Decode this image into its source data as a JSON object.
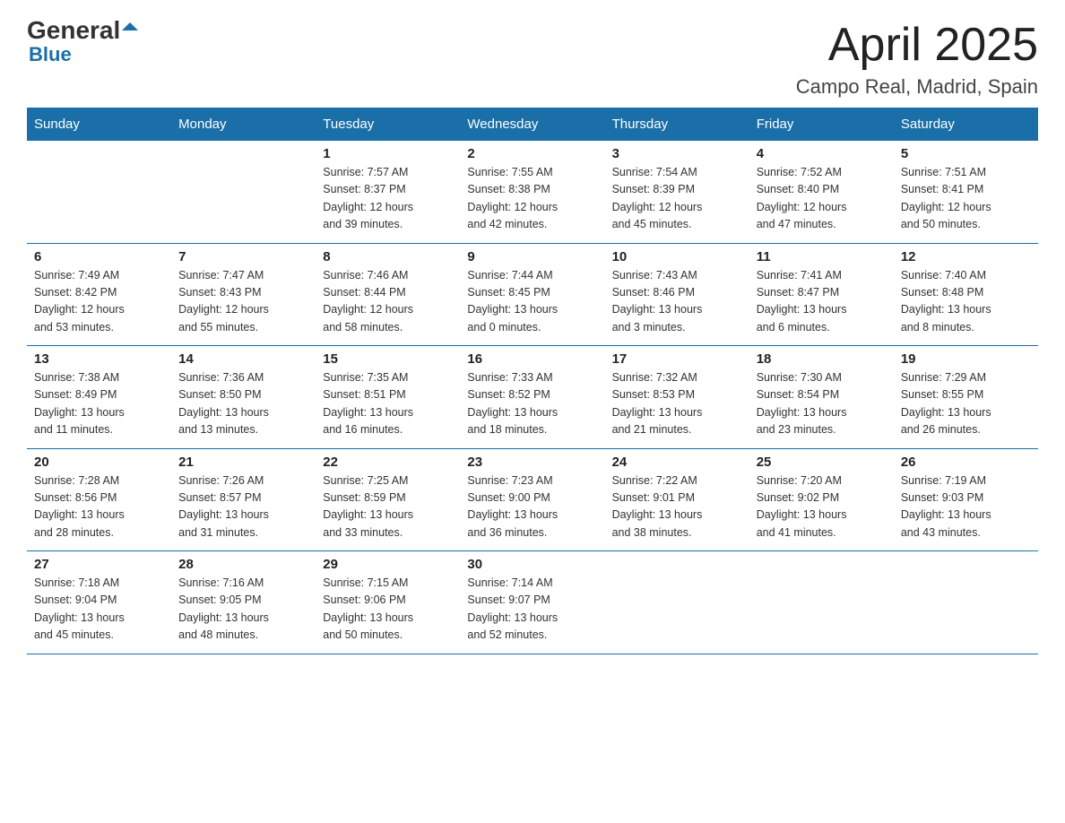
{
  "logo": {
    "text_general": "General",
    "text_blue": "Blue"
  },
  "title": "April 2025",
  "subtitle": "Campo Real, Madrid, Spain",
  "weekdays": [
    "Sunday",
    "Monday",
    "Tuesday",
    "Wednesday",
    "Thursday",
    "Friday",
    "Saturday"
  ],
  "weeks": [
    [
      {
        "day": "",
        "info": ""
      },
      {
        "day": "",
        "info": ""
      },
      {
        "day": "1",
        "info": "Sunrise: 7:57 AM\nSunset: 8:37 PM\nDaylight: 12 hours\nand 39 minutes."
      },
      {
        "day": "2",
        "info": "Sunrise: 7:55 AM\nSunset: 8:38 PM\nDaylight: 12 hours\nand 42 minutes."
      },
      {
        "day": "3",
        "info": "Sunrise: 7:54 AM\nSunset: 8:39 PM\nDaylight: 12 hours\nand 45 minutes."
      },
      {
        "day": "4",
        "info": "Sunrise: 7:52 AM\nSunset: 8:40 PM\nDaylight: 12 hours\nand 47 minutes."
      },
      {
        "day": "5",
        "info": "Sunrise: 7:51 AM\nSunset: 8:41 PM\nDaylight: 12 hours\nand 50 minutes."
      }
    ],
    [
      {
        "day": "6",
        "info": "Sunrise: 7:49 AM\nSunset: 8:42 PM\nDaylight: 12 hours\nand 53 minutes."
      },
      {
        "day": "7",
        "info": "Sunrise: 7:47 AM\nSunset: 8:43 PM\nDaylight: 12 hours\nand 55 minutes."
      },
      {
        "day": "8",
        "info": "Sunrise: 7:46 AM\nSunset: 8:44 PM\nDaylight: 12 hours\nand 58 minutes."
      },
      {
        "day": "9",
        "info": "Sunrise: 7:44 AM\nSunset: 8:45 PM\nDaylight: 13 hours\nand 0 minutes."
      },
      {
        "day": "10",
        "info": "Sunrise: 7:43 AM\nSunset: 8:46 PM\nDaylight: 13 hours\nand 3 minutes."
      },
      {
        "day": "11",
        "info": "Sunrise: 7:41 AM\nSunset: 8:47 PM\nDaylight: 13 hours\nand 6 minutes."
      },
      {
        "day": "12",
        "info": "Sunrise: 7:40 AM\nSunset: 8:48 PM\nDaylight: 13 hours\nand 8 minutes."
      }
    ],
    [
      {
        "day": "13",
        "info": "Sunrise: 7:38 AM\nSunset: 8:49 PM\nDaylight: 13 hours\nand 11 minutes."
      },
      {
        "day": "14",
        "info": "Sunrise: 7:36 AM\nSunset: 8:50 PM\nDaylight: 13 hours\nand 13 minutes."
      },
      {
        "day": "15",
        "info": "Sunrise: 7:35 AM\nSunset: 8:51 PM\nDaylight: 13 hours\nand 16 minutes."
      },
      {
        "day": "16",
        "info": "Sunrise: 7:33 AM\nSunset: 8:52 PM\nDaylight: 13 hours\nand 18 minutes."
      },
      {
        "day": "17",
        "info": "Sunrise: 7:32 AM\nSunset: 8:53 PM\nDaylight: 13 hours\nand 21 minutes."
      },
      {
        "day": "18",
        "info": "Sunrise: 7:30 AM\nSunset: 8:54 PM\nDaylight: 13 hours\nand 23 minutes."
      },
      {
        "day": "19",
        "info": "Sunrise: 7:29 AM\nSunset: 8:55 PM\nDaylight: 13 hours\nand 26 minutes."
      }
    ],
    [
      {
        "day": "20",
        "info": "Sunrise: 7:28 AM\nSunset: 8:56 PM\nDaylight: 13 hours\nand 28 minutes."
      },
      {
        "day": "21",
        "info": "Sunrise: 7:26 AM\nSunset: 8:57 PM\nDaylight: 13 hours\nand 31 minutes."
      },
      {
        "day": "22",
        "info": "Sunrise: 7:25 AM\nSunset: 8:59 PM\nDaylight: 13 hours\nand 33 minutes."
      },
      {
        "day": "23",
        "info": "Sunrise: 7:23 AM\nSunset: 9:00 PM\nDaylight: 13 hours\nand 36 minutes."
      },
      {
        "day": "24",
        "info": "Sunrise: 7:22 AM\nSunset: 9:01 PM\nDaylight: 13 hours\nand 38 minutes."
      },
      {
        "day": "25",
        "info": "Sunrise: 7:20 AM\nSunset: 9:02 PM\nDaylight: 13 hours\nand 41 minutes."
      },
      {
        "day": "26",
        "info": "Sunrise: 7:19 AM\nSunset: 9:03 PM\nDaylight: 13 hours\nand 43 minutes."
      }
    ],
    [
      {
        "day": "27",
        "info": "Sunrise: 7:18 AM\nSunset: 9:04 PM\nDaylight: 13 hours\nand 45 minutes."
      },
      {
        "day": "28",
        "info": "Sunrise: 7:16 AM\nSunset: 9:05 PM\nDaylight: 13 hours\nand 48 minutes."
      },
      {
        "day": "29",
        "info": "Sunrise: 7:15 AM\nSunset: 9:06 PM\nDaylight: 13 hours\nand 50 minutes."
      },
      {
        "day": "30",
        "info": "Sunrise: 7:14 AM\nSunset: 9:07 PM\nDaylight: 13 hours\nand 52 minutes."
      },
      {
        "day": "",
        "info": ""
      },
      {
        "day": "",
        "info": ""
      },
      {
        "day": "",
        "info": ""
      }
    ]
  ]
}
